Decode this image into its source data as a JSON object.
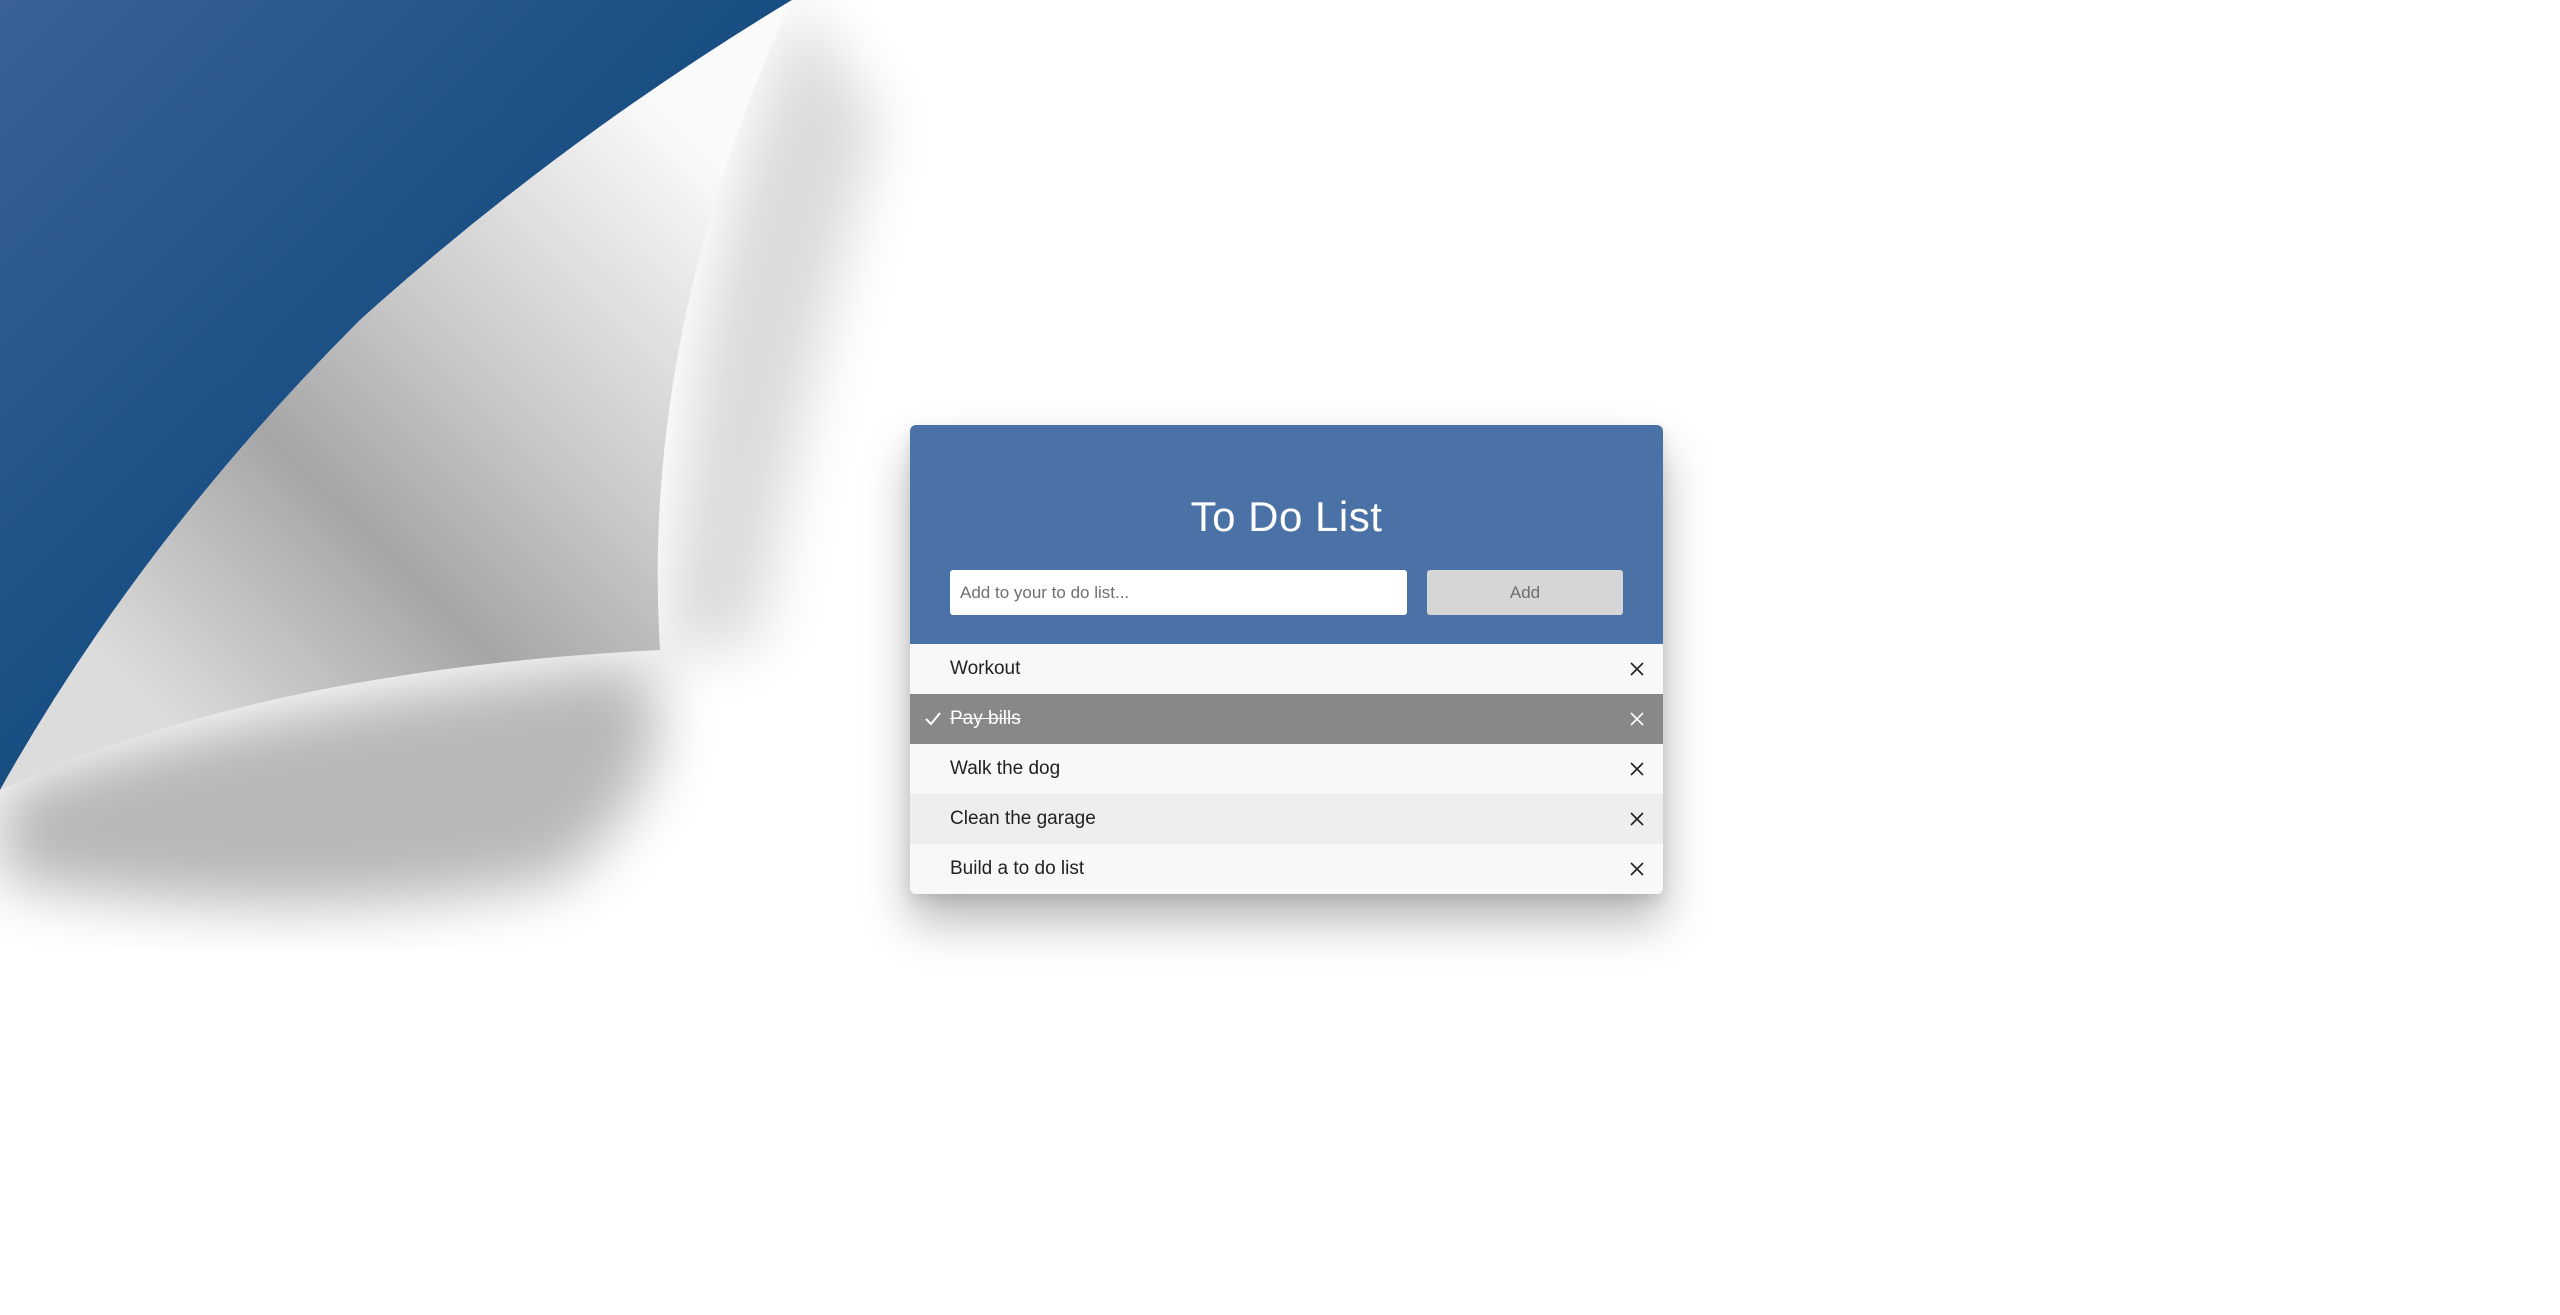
{
  "app": {
    "title": "To Do List"
  },
  "input": {
    "placeholder": "Add to your to do list...",
    "value": ""
  },
  "add_button": {
    "label": "Add"
  },
  "items": [
    {
      "label": "Workout",
      "checked": false
    },
    {
      "label": "Pay bills",
      "checked": true
    },
    {
      "label": "Walk the dog",
      "checked": false
    },
    {
      "label": "Clean the garage",
      "checked": false
    },
    {
      "label": "Build a to do list",
      "checked": false
    }
  ],
  "icons": {
    "check": "check-icon",
    "close": "close-icon"
  },
  "colors": {
    "header": "#4a72a6",
    "checked_row": "#888888",
    "row_odd": "#f8f8f8",
    "row_even": "#eeeeee",
    "curl_blue": "#0f4677",
    "add_button": "#d6d6d6"
  }
}
